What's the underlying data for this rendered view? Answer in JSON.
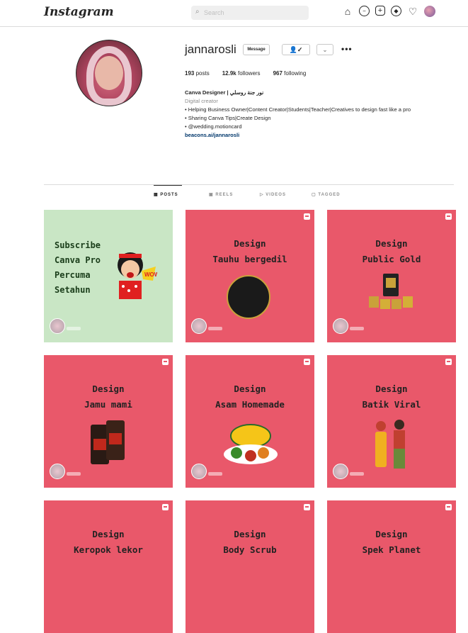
{
  "nav": {
    "logo": "Instagram",
    "search_placeholder": "Search",
    "icons": [
      "home-icon",
      "messenger-icon",
      "new-post-icon",
      "explore-icon",
      "activity-heart-icon",
      "avatar"
    ]
  },
  "profile": {
    "username": "jannarosli",
    "message_label": "Message",
    "follow_icon": "👤✓",
    "stats": {
      "posts_count": "193",
      "posts_label": "posts",
      "followers_count": "12.9k",
      "followers_label": "followers",
      "following_count": "967",
      "following_label": "following"
    },
    "bio": {
      "name": "Canva Designer | نور جنة روسلي",
      "category": "Digital creator",
      "line1": "• Helping Business Owner|Content Creator|Students|Teacher|Creatives to design fast like a pro",
      "line2": "• Sharing Canva Tips|Create Design",
      "line3": "• @wedding.motioncard",
      "link": "beacons.ai/jannarosli"
    }
  },
  "tabs": [
    {
      "label": "POSTS",
      "icon": "grid-icon"
    },
    {
      "label": "REELS",
      "icon": "reels-icon"
    },
    {
      "label": "VIDEOS",
      "icon": "video-icon"
    },
    {
      "label": "TAGGED",
      "icon": "tag-icon"
    }
  ],
  "posts": [
    {
      "lines": [
        "Subscribe",
        "Canva Pro",
        "Percuma",
        "Setahun"
      ],
      "bg": "#c9e6c5"
    },
    {
      "title": "Design",
      "subtitle": "Tauhu bergedil",
      "bg": "#e9586a"
    },
    {
      "title": "Design",
      "subtitle": "Public Gold",
      "bg": "#e9586a"
    },
    {
      "title": "Design",
      "subtitle": "Jamu mami",
      "bg": "#e9586a"
    },
    {
      "title": "Design",
      "subtitle": "Asam Homemade",
      "bg": "#e9586a"
    },
    {
      "title": "Design",
      "subtitle": "Batik Viral",
      "bg": "#e9586a"
    },
    {
      "title": "Design",
      "subtitle": "Keropok lekor",
      "bg": "#e9586a"
    },
    {
      "title": "Design",
      "subtitle": "Body Scrub",
      "bg": "#e9586a"
    },
    {
      "title": "Design",
      "subtitle": "Spek Planet",
      "bg": "#e9586a"
    }
  ],
  "colors": {
    "tile_pink": "#e9586a",
    "tile_green": "#c9e6c5",
    "link": "#00376b"
  }
}
